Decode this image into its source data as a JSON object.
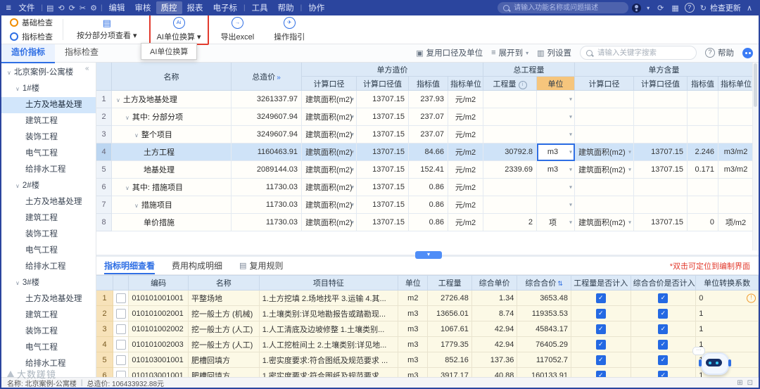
{
  "colors": {
    "menubar_bg": "#2b459e",
    "accent_blue": "#2f6fe4",
    "highlight_red": "#e23b2e",
    "header_orange": "#f6c57c",
    "check_orange": "#f08c00",
    "selected_row": "#cfe3f8",
    "bottom_cell_yellow": "#fcf9e6"
  },
  "menubar": {
    "logo_label": "文件",
    "quick_icons": [
      {
        "name": "new-file-icon",
        "glyph": "▤"
      },
      {
        "name": "undo-icon",
        "glyph": "⟲"
      },
      {
        "name": "redo-icon",
        "glyph": "⟳"
      },
      {
        "name": "scissors-icon",
        "glyph": "✂"
      },
      {
        "name": "settings-icon",
        "glyph": "⚙"
      }
    ],
    "items": [
      {
        "label": "编辑"
      },
      {
        "label": "审核"
      },
      {
        "label": "质控",
        "active": true
      },
      {
        "label": "报表"
      },
      {
        "label": "电子标"
      },
      {
        "label": "工具",
        "sep_before": true
      },
      {
        "label": "帮助"
      },
      {
        "label": "协作",
        "sep_before": true
      }
    ],
    "search_placeholder": "请输入功能名称或问题描述",
    "update_label": "检查更新"
  },
  "toolbar": {
    "checks": [
      {
        "label": "基础检查"
      },
      {
        "label": "指标检查"
      }
    ],
    "buttons": [
      {
        "label": "按分部分项查看",
        "dropdown": true,
        "icon": "subsection-view-icon",
        "highlight": false
      },
      {
        "label": "AI单位换算",
        "dropdown": true,
        "icon": "ai-unit-convert-icon",
        "highlight": true
      },
      {
        "label": "导出excel",
        "dropdown": false,
        "icon": "export-excel-icon",
        "highlight": false
      },
      {
        "label": "操作指引",
        "dropdown": false,
        "icon": "operation-guide-icon",
        "highlight": false
      }
    ],
    "tooltip": "AI单位换算"
  },
  "view_tabs": {
    "items": [
      {
        "label": "造价指标",
        "active": true
      },
      {
        "label": "指标检查",
        "active": false
      }
    ],
    "actions": [
      {
        "label": "复用口径及单位"
      },
      {
        "label": "展开到",
        "dropdown": true
      },
      {
        "label": "列设置"
      }
    ],
    "search_placeholder": "请输入关键字搜索",
    "help_label": "帮助"
  },
  "sidebar": {
    "items": [
      {
        "label": "北京案例-公寓楼",
        "level": 0,
        "caret": true
      },
      {
        "label": "1#楼",
        "level": 1,
        "caret": true
      },
      {
        "label": "土方及地基处理",
        "level": 2,
        "selected": true
      },
      {
        "label": "建筑工程",
        "level": 2
      },
      {
        "label": "装饰工程",
        "level": 2
      },
      {
        "label": "电气工程",
        "level": 2
      },
      {
        "label": "给排水工程",
        "level": 2
      },
      {
        "label": "2#楼",
        "level": 1,
        "caret": true
      },
      {
        "label": "土方及地基处理",
        "level": 2
      },
      {
        "label": "建筑工程",
        "level": 2
      },
      {
        "label": "装饰工程",
        "level": 2
      },
      {
        "label": "电气工程",
        "level": 2
      },
      {
        "label": "给排水工程",
        "level": 2
      },
      {
        "label": "3#楼",
        "level": 1,
        "caret": true
      },
      {
        "label": "土方及地基处理",
        "level": 2
      },
      {
        "label": "建筑工程",
        "level": 2
      },
      {
        "label": "装饰工程",
        "level": 2
      },
      {
        "label": "电气工程",
        "level": 2
      },
      {
        "label": "给排水工程",
        "level": 2
      }
    ]
  },
  "main_table": {
    "groups": {
      "name": "名称",
      "total": "总造价",
      "unit_price": "单方造价",
      "total_qty": "总工程量",
      "unit_content": "单方含量"
    },
    "sub_headers": [
      "计算口径",
      "计算口径值",
      "指标值",
      "指标单位",
      "工程量",
      "单位",
      "计算口径",
      "计算口径值",
      "指标值",
      "指标单位"
    ],
    "rows": [
      {
        "num": "1",
        "caret": true,
        "indent": 0,
        "name": "土方及地基处理",
        "total": "3261337.97",
        "cal1": "建筑面积(m2)",
        "calv1": "13707.15",
        "val1": "237.93",
        "unit1": "元/m2",
        "qty": "",
        "unit": "",
        "cal2": "",
        "calv2": "",
        "val2": "",
        "unit2": ""
      },
      {
        "num": "2",
        "caret": true,
        "indent": 1,
        "name": "其中: 分部分项",
        "total": "3249607.94",
        "cal1": "建筑面积(m2)",
        "calv1": "13707.15",
        "val1": "237.07",
        "unit1": "元/m2",
        "qty": "",
        "unit": "",
        "cal2": "",
        "calv2": "",
        "val2": "",
        "unit2": ""
      },
      {
        "num": "3",
        "caret": true,
        "indent": 2,
        "name": "整个项目",
        "total": "3249607.94",
        "cal1": "建筑面积(m2)",
        "calv1": "13707.15",
        "val1": "237.07",
        "unit1": "元/m2",
        "qty": "",
        "unit": "",
        "cal2": "",
        "calv2": "",
        "val2": "",
        "unit2": ""
      },
      {
        "num": "4",
        "caret": false,
        "indent": 3,
        "name": "土方工程",
        "total": "1160463.91",
        "cal1": "建筑面积(m2)",
        "calv1": "13707.15",
        "val1": "84.66",
        "unit1": "元/m2",
        "qty": "30792.8",
        "unit": "m3",
        "unit_editing": true,
        "selected": true,
        "cal2": "建筑面积(m2)",
        "calv2": "13707.15",
        "val2": "2.246",
        "unit2": "m3/m2"
      },
      {
        "num": "5",
        "caret": false,
        "indent": 3,
        "name": "地基处理",
        "total": "2089144.03",
        "cal1": "建筑面积(m2)",
        "calv1": "13707.15",
        "val1": "152.41",
        "unit1": "元/m2",
        "qty": "2339.69",
        "unit": "m3",
        "cal2": "建筑面积(m2)",
        "calv2": "13707.15",
        "val2": "0.171",
        "unit2": "m3/m2"
      },
      {
        "num": "6",
        "caret": true,
        "indent": 1,
        "name": "其中: 措施项目",
        "total": "11730.03",
        "cal1": "建筑面积(m2)",
        "calv1": "13707.15",
        "val1": "0.86",
        "unit1": "元/m2",
        "qty": "",
        "unit": "",
        "cal2": "",
        "calv2": "",
        "val2": "",
        "unit2": ""
      },
      {
        "num": "7",
        "caret": true,
        "indent": 2,
        "name": "措施项目",
        "total": "11730.03",
        "cal1": "建筑面积(m2)",
        "calv1": "13707.15",
        "val1": "0.86",
        "unit1": "元/m2",
        "qty": "",
        "unit": "",
        "cal2": "",
        "calv2": "",
        "val2": "",
        "unit2": ""
      },
      {
        "num": "8",
        "caret": false,
        "indent": 3,
        "name": "单价措施",
        "total": "11730.03",
        "cal1": "建筑面积(m2)",
        "calv1": "13707.15",
        "val1": "0.86",
        "unit1": "元/m2",
        "qty": "2",
        "unit": "项",
        "cal2": "建筑面积(m2)",
        "calv2": "13707.15",
        "val2": "0",
        "unit2": "项/m2"
      }
    ]
  },
  "detail_panel": {
    "tabs": [
      {
        "label": "指标明细查看",
        "active": true
      },
      {
        "label": "费用构成明细"
      },
      {
        "label": "复用规则",
        "icon": "rules-icon"
      }
    ],
    "note": "*双击可定位到编制界面",
    "headers": [
      "编码",
      "名称",
      "项目特征",
      "单位",
      "工程量",
      "综合单价",
      "综合合价",
      "工程量是否计入",
      "综合合价是否计入",
      "单位转换系数"
    ],
    "rows": [
      {
        "num": "1",
        "code": "010101001001",
        "name": "平整场地",
        "feature": "1.土方挖填 2.场地找平 3.运输 4.其...",
        "unit": "m2",
        "qty": "2726.48",
        "price": "1.34",
        "total": "3653.48",
        "qty_in": true,
        "total_in": true,
        "factor": "0",
        "warn": true
      },
      {
        "num": "2",
        "code": "010101002001",
        "name": "挖一般土方 (机械)",
        "feature": "1.土壤类别:详见地勘报告或踏勘现...",
        "unit": "m3",
        "qty": "13656.01",
        "price": "8.74",
        "total": "119353.53",
        "qty_in": true,
        "total_in": true,
        "factor": "1",
        "warn": false
      },
      {
        "num": "3",
        "code": "010101002002",
        "name": "挖一般土方 (人工)",
        "feature": "1.人工清底及边坡修整 1.土壤类别...",
        "unit": "m3",
        "qty": "1067.61",
        "price": "42.94",
        "total": "45843.17",
        "qty_in": true,
        "total_in": true,
        "factor": "1",
        "warn": false
      },
      {
        "num": "4",
        "code": "010101002003",
        "name": "挖一般土方 (人工)",
        "feature": "1.人工挖桩间土 2.土壤类别:详见地...",
        "unit": "m3",
        "qty": "1779.35",
        "price": "42.94",
        "total": "76405.29",
        "qty_in": true,
        "total_in": true,
        "factor": "1",
        "warn": false
      },
      {
        "num": "5",
        "code": "010103001001",
        "name": "肥槽回填方",
        "feature": "1.密实度要求:符合图纸及规范要求 ...",
        "unit": "m3",
        "qty": "852.16",
        "price": "137.36",
        "total": "117052.7",
        "qty_in": true,
        "total_in": true,
        "factor": "1",
        "warn": false
      },
      {
        "num": "6",
        "code": "010103001001",
        "name": "肥槽回填方",
        "feature": "1.密实度要求:符合图纸及规范要求...",
        "unit": "m3",
        "qty": "3917.17",
        "price": "40.88",
        "total": "160133.91",
        "qty_in": true,
        "total_in": true,
        "factor": "1",
        "warn": false
      }
    ]
  },
  "statusbar": {
    "name": "名称: 北京案例-公寓楼",
    "total": "总造价: 106433932.88元"
  },
  "watermark": {
    "text": "大数蹉镜"
  }
}
